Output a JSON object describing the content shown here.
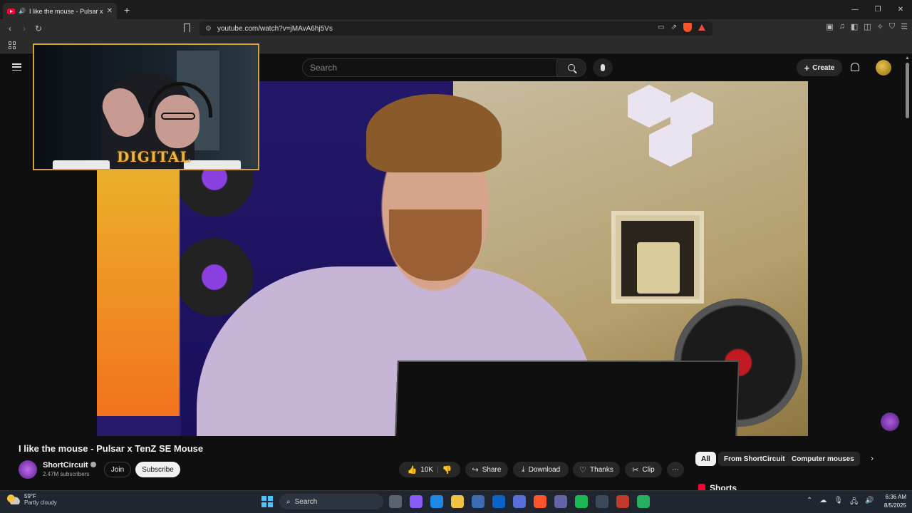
{
  "browser": {
    "tab_title": "I like the mouse - Pulsar x TenZ",
    "tab_close": "✕",
    "new_tab": "+",
    "url": "youtube.com/watch?v=jMAvA6hj5Vs",
    "window_controls": [
      "—",
      "❐",
      "✕"
    ]
  },
  "youtube": {
    "search_placeholder": "Search",
    "create_label": "Create",
    "video_title": "I like the mouse - Pulsar x TenZ SE Mouse",
    "channel_name": "ShortCircuit",
    "subscribers": "2.47M subscribers",
    "join_label": "Join",
    "subscribe_label": "Subscribe",
    "likes": "10K",
    "share_label": "Share",
    "download_label": "Download",
    "thanks_label": "Thanks",
    "clip_label": "Clip",
    "more_label": "···",
    "chips": [
      "All",
      "From ShortCircuit",
      "Computer mouses"
    ],
    "shorts_label": "Shorts"
  },
  "overlay": {
    "cam_logo": "DIGITAL"
  },
  "taskbar": {
    "temp": "59°F",
    "weather": "Partly cloudy",
    "search_label": "Search",
    "time": "6:36 AM",
    "date": "8/5/2025",
    "app_colors": [
      "#5a6470",
      "#8a5cf6",
      "#1e88e5",
      "#f0c040",
      "#3d6bb3",
      "#0a64c8",
      "#5a6cd6",
      "#fb542b",
      "#6264a7",
      "#1db954",
      "#3a4a5a",
      "#c0392b",
      "#27ae60"
    ]
  }
}
